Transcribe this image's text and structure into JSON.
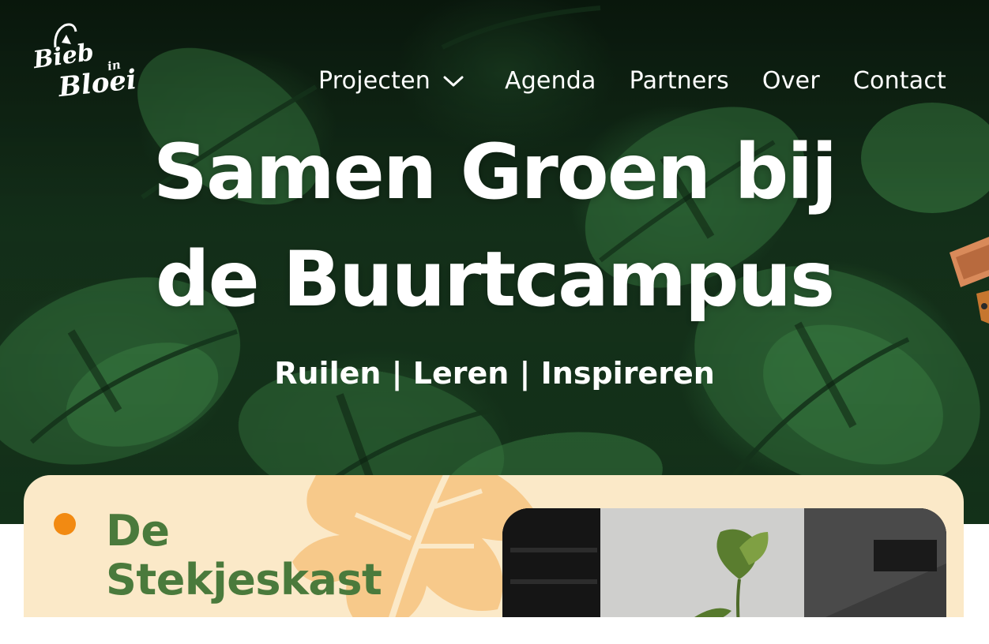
{
  "site": {
    "logo": {
      "line1": "Bieb",
      "line2": "in",
      "line3": "Bloei"
    }
  },
  "nav": {
    "items": [
      {
        "label": "Projecten",
        "icon": "chevron-down-icon"
      },
      {
        "label": "Agenda"
      },
      {
        "label": "Partners"
      },
      {
        "label": "Over"
      },
      {
        "label": "Contact"
      }
    ]
  },
  "hero": {
    "title_line1": "Samen Groen bij",
    "title_line2": "de Buurtcampus",
    "subtitle": "Ruilen | Leren | Inspireren"
  },
  "card": {
    "title_line1": "De",
    "title_line2": "Stekjeskast"
  },
  "colors": {
    "hero_bg": "#15321b",
    "card_bg": "#fbe9c8",
    "card_title": "#4a7a3c",
    "accent_dot": "#f28a12",
    "card_leaf": "#f7c98a",
    "text_light": "#ffffff"
  }
}
